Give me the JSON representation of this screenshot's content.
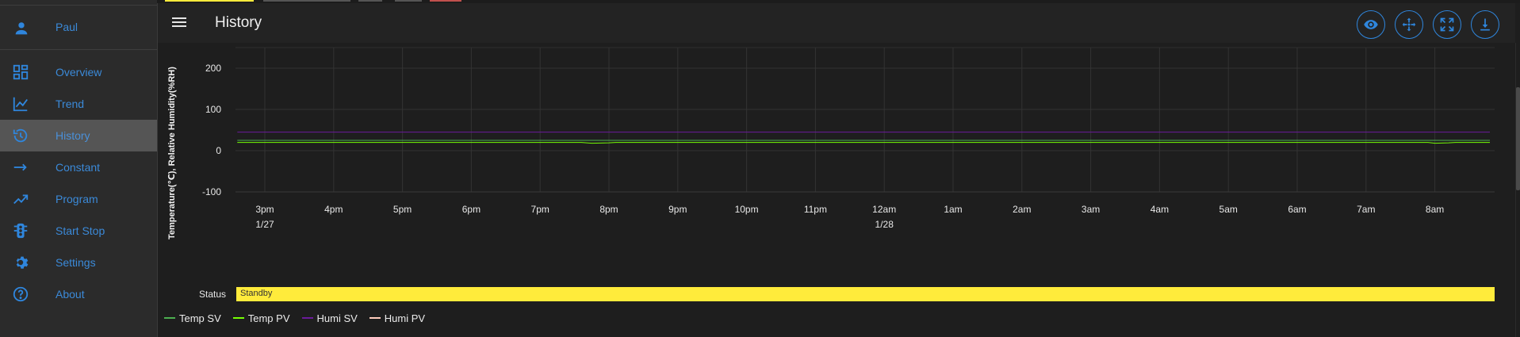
{
  "sidebar": {
    "user": {
      "label": "Paul",
      "icon": "person-icon"
    },
    "items": [
      {
        "id": "overview",
        "label": "Overview",
        "icon": "dashboard-icon",
        "active": false
      },
      {
        "id": "trend",
        "label": "Trend",
        "icon": "trend-line-icon",
        "active": false
      },
      {
        "id": "history",
        "label": "History",
        "icon": "history-icon",
        "active": true
      },
      {
        "id": "constant",
        "label": "Constant",
        "icon": "arrow-right-icon",
        "active": false
      },
      {
        "id": "program",
        "label": "Program",
        "icon": "trending-up-icon",
        "active": false
      },
      {
        "id": "start-stop",
        "label": "Start Stop",
        "icon": "traffic-light-icon",
        "active": false
      },
      {
        "id": "settings",
        "label": "Settings",
        "icon": "gear-icon",
        "active": false
      },
      {
        "id": "about",
        "label": "About",
        "icon": "help-circle-icon",
        "active": false
      }
    ]
  },
  "header": {
    "title": "History",
    "tools": [
      {
        "id": "view",
        "icon": "eye-icon"
      },
      {
        "id": "pan",
        "icon": "pan-move-icon"
      },
      {
        "id": "fullscreen",
        "icon": "fullscreen-icon"
      },
      {
        "id": "download",
        "icon": "download-icon"
      }
    ]
  },
  "colors": {
    "accent": "#2f86dd",
    "sidebar_link": "#3b8ad9",
    "status_standby": "#ffeb3b",
    "temp_sv": "#4caf50",
    "temp_pv": "#76ff03",
    "humi_sv": "#6a1b9a",
    "humi_pv": "#ffccbc"
  },
  "chart_data": {
    "type": "line",
    "ylabel": "Temperature(℃), Relative Humidity(%RH)",
    "ylim": [
      -100,
      250
    ],
    "yticks": [
      -100,
      0,
      100,
      200
    ],
    "xticks": [
      {
        "label": "3pm",
        "sub": "1/27"
      },
      {
        "label": "4pm",
        "sub": ""
      },
      {
        "label": "5pm",
        "sub": ""
      },
      {
        "label": "6pm",
        "sub": ""
      },
      {
        "label": "7pm",
        "sub": ""
      },
      {
        "label": "8pm",
        "sub": ""
      },
      {
        "label": "9pm",
        "sub": ""
      },
      {
        "label": "10pm",
        "sub": ""
      },
      {
        "label": "11pm",
        "sub": ""
      },
      {
        "label": "12am",
        "sub": "1/28"
      },
      {
        "label": "1am",
        "sub": ""
      },
      {
        "label": "2am",
        "sub": ""
      },
      {
        "label": "3am",
        "sub": ""
      },
      {
        "label": "4am",
        "sub": ""
      },
      {
        "label": "5am",
        "sub": ""
      },
      {
        "label": "6am",
        "sub": ""
      },
      {
        "label": "7am",
        "sub": ""
      },
      {
        "label": "8am",
        "sub": ""
      }
    ],
    "x_hours": [
      14.6,
      32.8
    ],
    "grid": true,
    "legend_placement": "bottom-left",
    "series": [
      {
        "name": "Temp SV",
        "color": "#4caf50",
        "values": [
          [
            14.6,
            25
          ],
          [
            32.8,
            25
          ]
        ]
      },
      {
        "name": "Temp PV",
        "color": "#76ff03",
        "values": [
          [
            14.6,
            20
          ],
          [
            19.6,
            20
          ],
          [
            19.75,
            18
          ],
          [
            20.0,
            19
          ],
          [
            20.1,
            20
          ],
          [
            31.9,
            20
          ],
          [
            32.0,
            18
          ],
          [
            32.2,
            19
          ],
          [
            32.3,
            20
          ],
          [
            32.8,
            20
          ]
        ]
      },
      {
        "name": "Humi SV",
        "color": "#6a1b9a",
        "values": [
          [
            14.6,
            45
          ],
          [
            32.8,
            45
          ]
        ]
      },
      {
        "name": "Humi PV",
        "color": "#ffccbc",
        "values": []
      }
    ]
  },
  "status": {
    "label": "Status",
    "value": "Standby"
  },
  "legend": [
    {
      "name": "Temp SV",
      "color": "#4caf50"
    },
    {
      "name": "Temp PV",
      "color": "#76ff03"
    },
    {
      "name": "Humi SV",
      "color": "#6a1b9a"
    },
    {
      "name": "Humi PV",
      "color": "#ffccbc"
    }
  ]
}
